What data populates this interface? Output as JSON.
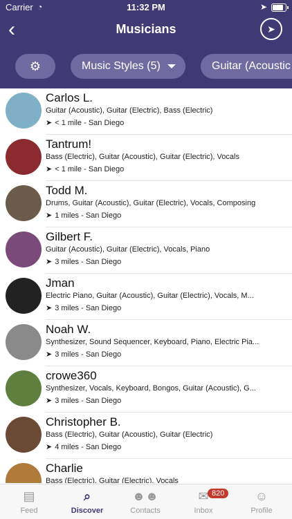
{
  "status": {
    "carrier": "Carrier",
    "time": "11:32 PM"
  },
  "nav": {
    "title": "Musicians"
  },
  "filters": [
    {
      "label": ""
    },
    {
      "label": "Music Styles (5)"
    },
    {
      "label": "Guitar (Acoustic"
    }
  ],
  "musicians": [
    {
      "name": "Carlos L.",
      "instruments": "Guitar (Acoustic), Guitar (Electric), Bass (Electric)",
      "location": "< 1 mile - San Diego",
      "avatar_color": "#7fb0c8"
    },
    {
      "name": "Tantrum!",
      "instruments": "Bass (Electric), Guitar (Acoustic), Guitar (Electric), Vocals",
      "location": "< 1 mile - San Diego",
      "avatar_color": "#8b2b2f"
    },
    {
      "name": "Todd M.",
      "instruments": "Drums, Guitar (Acoustic), Guitar (Electric), Vocals, Composing",
      "location": "1 miles - San Diego",
      "avatar_color": "#6b5b4b"
    },
    {
      "name": "Gilbert F.",
      "instruments": "Guitar (Acoustic), Guitar (Electric), Vocals, Piano",
      "location": "3 miles - San Diego",
      "avatar_color": "#7a4b7a"
    },
    {
      "name": "Jman",
      "instruments": "Electric Piano, Guitar (Acoustic), Guitar (Electric), Vocals, M...",
      "location": "3 miles - San Diego",
      "avatar_color": "#222222"
    },
    {
      "name": "Noah W.",
      "instruments": "Synthesizer, Sound Sequencer, Keyboard, Piano, Electric Pia...",
      "location": "3 miles - San Diego",
      "avatar_color": "#8a8a8a"
    },
    {
      "name": "crowe360",
      "instruments": "Synthesizer, Vocals, Keyboard, Bongos, Guitar (Acoustic), G...",
      "location": "3 miles - San Diego",
      "avatar_color": "#5f7f3f"
    },
    {
      "name": "Christopher B.",
      "instruments": "Bass (Electric), Guitar (Acoustic), Guitar (Electric)",
      "location": "4 miles - San Diego",
      "avatar_color": "#6b4a35"
    },
    {
      "name": "Charlie",
      "instruments": "Bass (Electric), Guitar (Electric), Vocals",
      "location": "",
      "avatar_color": "#b07a3a"
    }
  ],
  "tabbar": {
    "feed": "Feed",
    "discover": "Discover",
    "contacts": "Contacts",
    "inbox": "Inbox",
    "inbox_badge": "820",
    "profile": "Profile"
  },
  "colors": {
    "brand": "#3f3a74",
    "pill": "#6f6aa0",
    "badge": "#c0392b"
  }
}
